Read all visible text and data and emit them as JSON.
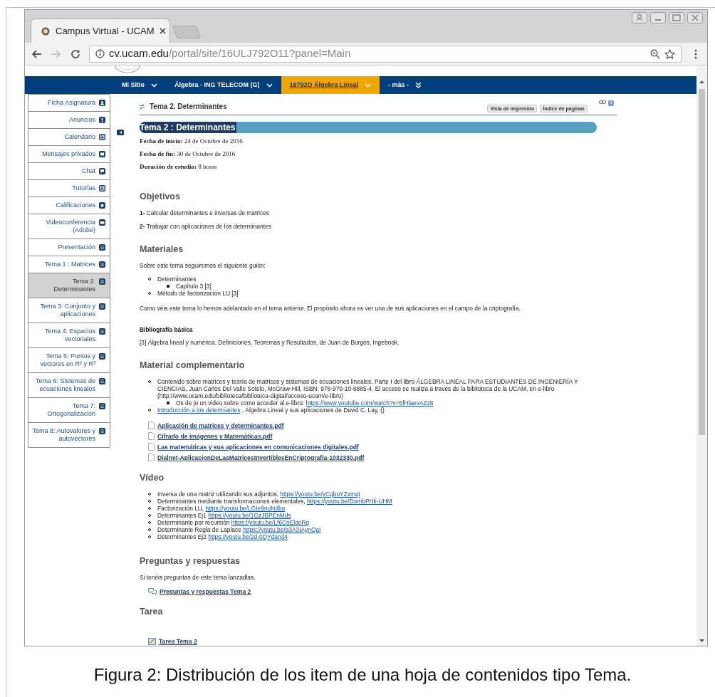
{
  "browser": {
    "tab_title": "Campus Virtual - UCAM",
    "url_host": "cv.ucam.edu",
    "url_path": "/portal/site/16ULJ792O11?panel=Main"
  },
  "nav": [
    {
      "label": "Mi Sitio",
      "selected": false,
      "kind": "menu"
    },
    {
      "label": "Álgebra - ING TELECOM (G)",
      "selected": false,
      "kind": "menu"
    },
    {
      "label": "16792O Álgebra Lineal",
      "selected": true,
      "kind": "menu"
    },
    {
      "label": "- más -",
      "selected": false,
      "kind": "more"
    }
  ],
  "sidebar": [
    {
      "label": "Ficha Asignatura",
      "selected": false
    },
    {
      "label": "Anuncios",
      "selected": false
    },
    {
      "label": "Calendario",
      "selected": false
    },
    {
      "label": "Mensajes privados",
      "selected": false
    },
    {
      "label": "Chat",
      "selected": false
    },
    {
      "label": "Tutorías",
      "selected": false
    },
    {
      "label": "Calificaciones",
      "selected": false
    },
    {
      "label": "Videoconferencia (Adobe)",
      "selected": false
    },
    {
      "label": "Presentación",
      "selected": false
    },
    {
      "label": "Tema 1 : Matrices",
      "selected": false
    },
    {
      "label": "Tema 2. Determinantes",
      "selected": true
    },
    {
      "label": "Tema 3: Conjunto y aplicaciones",
      "selected": false
    },
    {
      "label": "Tema 4: Espacios vectoriales",
      "selected": false
    },
    {
      "label": "Tema 5: Puntos y vectores en R² y R³",
      "selected": false
    },
    {
      "label": "Tema 6: Sistemas de ecuaciones lineales",
      "selected": false
    },
    {
      "label": "Tema 7: Ortogonalización",
      "selected": false
    },
    {
      "label": "Tema 8: Autovalores y autovectores",
      "selected": false
    }
  ],
  "tool": {
    "title": "Tema 2. Determinantes",
    "buttons": [
      "Vista de impresión",
      "Índice de páginas"
    ]
  },
  "banner": "Tema 2 : Determinantes",
  "meta": [
    {
      "label": "Fecha de inicio:",
      "value": "24 de Octubre de 2016"
    },
    {
      "label": "Fecha de fin:",
      "value": "30 de Octubre de 2016"
    },
    {
      "label": "Duración de estudio:",
      "value": "8 horas"
    }
  ],
  "sections": [
    {
      "heading": "Objetivos",
      "blocks": [
        {
          "kind": "para",
          "text": "**1-** Calcular determinantes e inversas de matrices"
        },
        {
          "kind": "para",
          "text": "**2-** Trabajar con aplicaciones de los determinantes"
        }
      ]
    },
    {
      "heading": "Materiales",
      "blocks": [
        {
          "kind": "para",
          "text": "Sobre este tema seguiremos el siguiente guión:"
        },
        {
          "kind": "list",
          "items": [
            {
              "parts": [
                {
                  "kind": "text",
                  "text": "Determinantes"
                }
              ],
              "children": [
                {
                  "parts": [
                    {
                      "kind": "text",
                      "text": "Capítulo 3 [3]"
                    }
                  ]
                }
              ]
            },
            {
              "parts": [
                {
                  "kind": "text",
                  "text": "Método de factorización LU [3]"
                }
              ]
            }
          ]
        },
        {
          "kind": "para",
          "text": "Como véis este tema lo hemos adelantado en el tema anterior. El propósito ahora es ver una de sus aplicaciones en el campo de la criptografía."
        },
        {
          "kind": "subheading",
          "text": "Bibliografía básica"
        },
        {
          "kind": "para",
          "text": "[3] Álgebra lineal y numérica. Definiciones, Teoremas y Resultados, de Juan de Burgos, Ingebook."
        }
      ]
    },
    {
      "heading": "Material complementario",
      "blocks": [
        {
          "kind": "list",
          "items": [
            {
              "parts": [
                {
                  "kind": "text",
                  "text": "Contenido sobre matrices y teoría de matrices y sistemas de ecuaciones lineales. Parte I del libro ÁLGEBRA LINEAL PARA ESTUDIANTES DE INGENIERÍA Y CIENCIAS, Juan Carlos Del Valle Sotelo, McGraw-Hill, ISBN: 978-970-10-6885-4. El acceso se realiza a través de la biblioteca de la UCAM, en e-libro (http://www.ucam.edu/biblioteca/biblioteca-digital/acceso-ucam/e-libro)"
                }
              ],
              "children": [
                {
                  "parts": [
                    {
                      "kind": "text",
                      "text": "Os de jo un video sobre como acceder al e-libro:"
                    },
                    {
                      "kind": "link",
                      "text": "https://www.youtube.com/watch?v=5fHlaevAZz8"
                    }
                  ]
                }
              ]
            },
            {
              "parts": [
                {
                  "kind": "link",
                  "text": "Introducción a los determiantes"
                },
                {
                  "kind": "text",
                  "text": ", Álgebra Lineal y sus aplicaciones de David C. Lay, ()"
                }
              ]
            }
          ]
        },
        {
          "kind": "files",
          "items": [
            "Aplicación de matrices y determinantes.pdf",
            "Cifrado de imágenes y Matemáticas.pdf",
            "Las matemáticas y sus aplicaciones en comunicaciones digitales.pdf",
            "Dialnet-AplicacionDeLasMatricesInvertiblesEnCriptografia-1032330.pdf"
          ]
        }
      ]
    },
    {
      "heading": "Vídeo",
      "blocks": [
        {
          "kind": "list",
          "items": [
            {
              "parts": [
                {
                  "kind": "text",
                  "text": "Inversa de una matriz utilizando sus adjuntos,"
                },
                {
                  "kind": "link",
                  "text": "https://youtu.be/yCqbuYZxmqI"
                }
              ]
            },
            {
              "parts": [
                {
                  "kind": "text",
                  "text": "Determinantes mediante transformaciones elementales,"
                },
                {
                  "kind": "link",
                  "text": "https://youtu.be/DombPHk-UHM"
                }
              ]
            },
            {
              "parts": [
                {
                  "kind": "text",
                  "text": "Factorización LU,"
                },
                {
                  "kind": "link",
                  "text": "https://youtu.be/LGIe9nuNdbo"
                }
              ]
            },
            {
              "parts": [
                {
                  "kind": "text",
                  "text": "Determinantes Ej1"
                },
                {
                  "kind": "link",
                  "text": "https://youtu.be/1GzJBPEnMds"
                }
              ]
            },
            {
              "parts": [
                {
                  "kind": "text",
                  "text": "Determinante por recursión"
                },
                {
                  "kind": "link",
                  "text": "https://youtu.be/Lf6CoElqoRg"
                }
              ]
            },
            {
              "parts": [
                {
                  "kind": "text",
                  "text": "Determinante Regla de Laplace"
                },
                {
                  "kind": "link",
                  "text": "https://youtu.be/a3A3IAynQaI"
                }
              ]
            },
            {
              "parts": [
                {
                  "kind": "text",
                  "text": "Determinantes Ej2"
                },
                {
                  "kind": "link",
                  "text": "https://youtu.be/2d-0QYdan34"
                }
              ]
            }
          ]
        }
      ]
    },
    {
      "heading": "Preguntas y respuestas",
      "blocks": [
        {
          "kind": "para",
          "text": "Si tenéis preguntas de este tema lanzadlas."
        },
        {
          "kind": "forum_link",
          "text": "Preguntas y respuestas Tema 2"
        }
      ]
    },
    {
      "heading": "Tarea",
      "blocks": [
        {
          "kind": "task_link",
          "text": "Tarea Tema 2"
        }
      ]
    }
  ],
  "caption": "Figura 2: Distribución de los item de una hoja de contenidos tipo Tema."
}
